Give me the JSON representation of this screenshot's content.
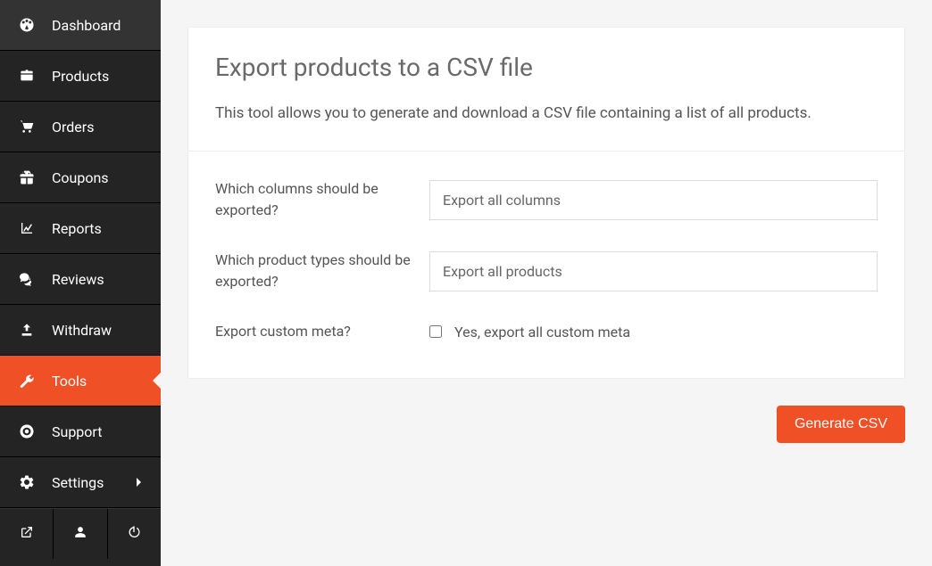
{
  "sidebar": {
    "items": [
      {
        "label": "Dashboard",
        "icon": "dashboard-icon",
        "active": false
      },
      {
        "label": "Products",
        "icon": "briefcase-icon",
        "active": false
      },
      {
        "label": "Orders",
        "icon": "cart-icon",
        "active": false
      },
      {
        "label": "Coupons",
        "icon": "gift-icon",
        "active": false
      },
      {
        "label": "Reports",
        "icon": "chart-icon",
        "active": false
      },
      {
        "label": "Reviews",
        "icon": "comments-icon",
        "active": false
      },
      {
        "label": "Withdraw",
        "icon": "upload-icon",
        "active": false
      },
      {
        "label": "Tools",
        "icon": "wrench-icon",
        "active": true
      },
      {
        "label": "Support",
        "icon": "lifering-icon",
        "active": false
      },
      {
        "label": "Settings",
        "icon": "gear-icon",
        "active": false,
        "chevron": true
      }
    ],
    "footer": [
      {
        "icon": "external-link-icon"
      },
      {
        "icon": "user-icon"
      },
      {
        "icon": "power-icon"
      }
    ]
  },
  "panel": {
    "title": "Export products to a CSV file",
    "description": "This tool allows you to generate and download a CSV file containing a list of all products."
  },
  "form": {
    "columns_label": "Which columns should be exported?",
    "columns_value": "Export all columns",
    "types_label": "Which product types should be exported?",
    "types_value": "Export all products",
    "meta_label": "Export custom meta?",
    "meta_checkbox_label": "Yes, export all custom meta",
    "meta_checked": false
  },
  "actions": {
    "generate_label": "Generate CSV"
  },
  "colors": {
    "accent": "#f05025",
    "sidebar_bg": "#242424"
  }
}
